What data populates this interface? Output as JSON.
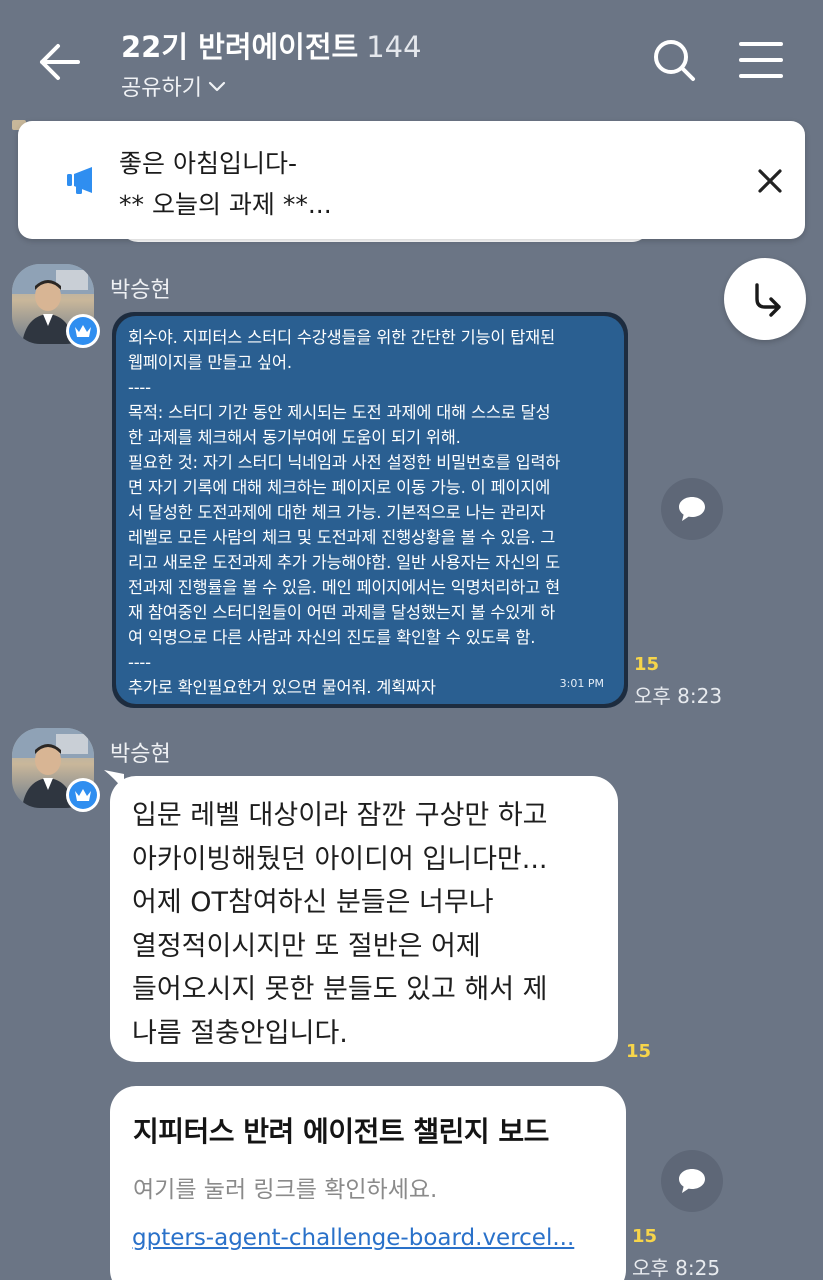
{
  "header": {
    "title": "22기 반려에이전트",
    "member_count": "144",
    "share_label": "공유하기"
  },
  "notice": {
    "line1": "좋은 아침입니다-",
    "line2": "** 오늘의 과제 **..."
  },
  "messages": [
    {
      "sender": "박승현",
      "image_text": "회수야. 지피터스 스터디 수강생들을 위한 간단한 기능이 탑재된\n웹페이지를 만들고 싶어.\n----\n목적: 스터디 기간 동안 제시되는 도전 과제에 대해 스스로 달성\n한 과제를 체크해서 동기부여에 도움이 되기 위해.\n필요한 것: 자기 스터디 닉네임과 사전 설정한 비밀번호를 입력하\n면 자기 기록에 대해 체크하는 페이지로 이동 가능. 이 페이지에\n서 달성한 도전과제에 대한 체크 가능. 기본적으로 나는 관리자\n레벨로 모든 사람의 체크 및 도전과제 진행상황을 볼 수 있음. 그\n리고 새로운 도전과제 추가 가능해야함. 일반 사용자는 자신의 도\n전과제 진행률을 볼 수 있음. 메인 페이지에서는 익명처리하고 현\n재 참여중인 스터디원들이 어떤 과제를 달성했는지 볼 수있게 하\n여 익명으로 다른 사람과 자신의 진도를 확인할 수 있도록 함.\n----\n추가로 확인필요한거 있으면 물어줘. 계획짜자",
      "image_time": "3:01 PM",
      "unread": "15",
      "time": "오후 8:23"
    },
    {
      "sender": "박승현",
      "text": "입문 레벨 대상이라 잠깐 구상만 하고\n아카이빙해뒀던 아이디어 입니다만...\n어제 OT참여하신 분들은 너무나\n열정적이시지만 또 절반은 어제\n들어오시지 못한 분들도 있고 해서 제\n나름 절충안입니다.",
      "unread": "15"
    },
    {
      "link_title": "지피터스 반려 에이전트 챌린지 보드",
      "link_desc": "여기를 눌러 링크를 확인하세요.",
      "link_url": "gpters-agent-challenge-board.vercel...",
      "unread": "15",
      "time": "오후 8:25"
    }
  ],
  "colors": {
    "background": "#6b7585",
    "bubble": "#ffffff",
    "unread": "#f7d54a",
    "link": "#2a71c9",
    "notice_icon": "#2f8ef0"
  },
  "icons": [
    "back-arrow-icon",
    "chevron-down-icon",
    "search-icon",
    "menu-icon",
    "megaphone-icon",
    "close-icon",
    "reply-arrow-icon",
    "comment-icon",
    "crown-icon"
  ]
}
